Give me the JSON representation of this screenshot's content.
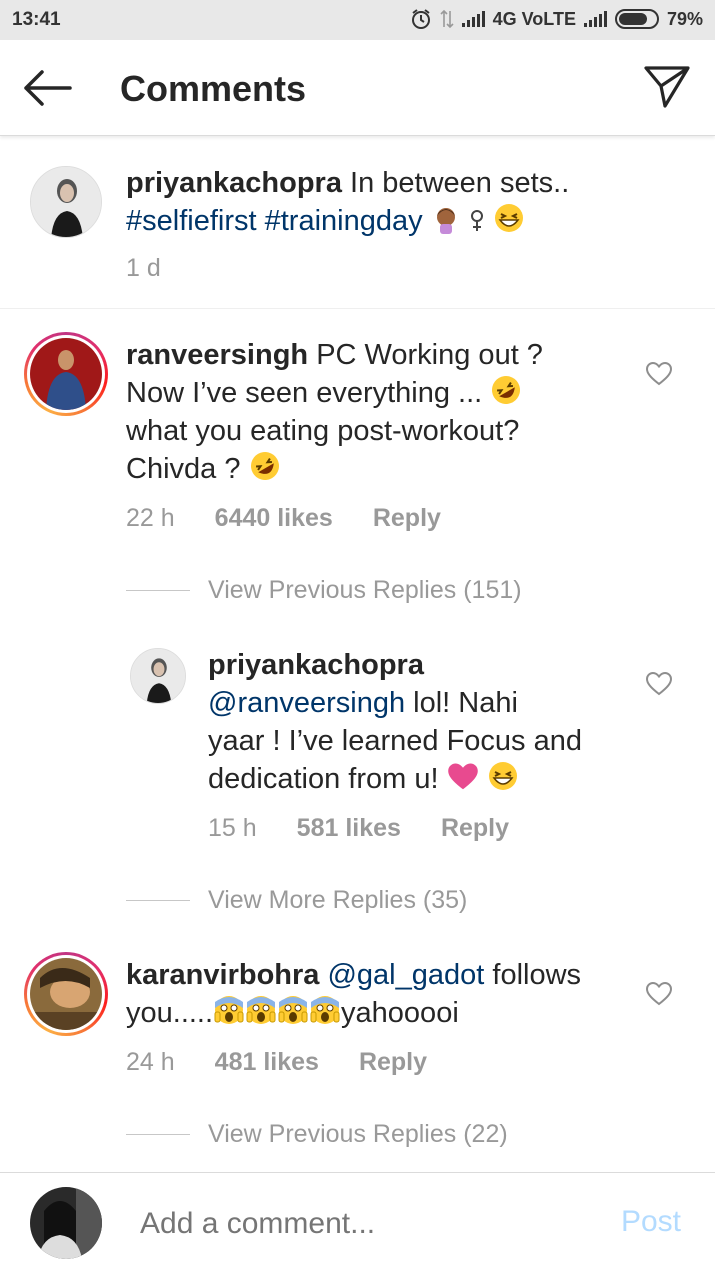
{
  "status_bar": {
    "time": "13:41",
    "network": "4G VoLTE",
    "battery": "79%"
  },
  "header": {
    "title": "Comments"
  },
  "caption": {
    "username": "priyankachopra",
    "text": "In between sets..",
    "hashtags": "#selfiefirst #trainingday",
    "time": "1 d"
  },
  "comments": [
    {
      "username": "ranveersingh",
      "line1": "PC Working out ?",
      "line2": "Now I’ve seen everything ...",
      "line3": "what you eating post-workout?",
      "line4": "Chivda ?",
      "time": "22 h",
      "likes": "6440 likes",
      "reply": "Reply",
      "view_replies": "View Previous Replies (151)"
    },
    {
      "username": "priyankachopra",
      "mention": "@ranveersingh",
      "line1_rest": "lol! Nahi",
      "line2": "yaar ! I’ve learned Focus and",
      "line3": "dedication from u!",
      "time": "15 h",
      "likes": "581 likes",
      "reply": "Reply",
      "view_replies": "View More Replies (35)"
    },
    {
      "username": "karanvirbohra",
      "mention": "@gal_gadot",
      "line1_rest": "follows",
      "line2_start": "you.....",
      "line2_end": "yahooooi",
      "time": "24 h",
      "likes": "481 likes",
      "reply": "Reply",
      "view_replies": "View Previous Replies (22)"
    }
  ],
  "composer": {
    "placeholder": "Add a comment...",
    "post_label": "Post"
  },
  "colors": {
    "accent_link": "#003569",
    "post_disabled": "#b3dbff",
    "secondary_text": "#999999"
  }
}
